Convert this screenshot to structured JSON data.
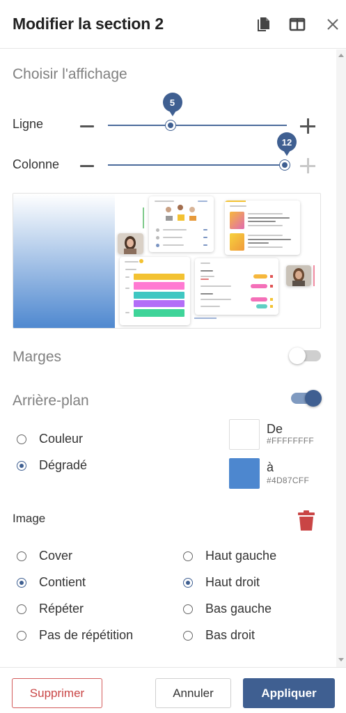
{
  "header": {
    "title": "Modifier la section 2",
    "icons": [
      "copy-icon",
      "columns-layout-icon",
      "close-icon"
    ]
  },
  "layout": {
    "section_title": "Choisir l'affichage",
    "row_label": "Ligne",
    "row_value": "5",
    "row_fraction": 0.36,
    "column_label": "Colonne",
    "column_value": "12",
    "column_fraction": 1.0
  },
  "preview": {
    "icons": [
      "layout-preview-thumbnail"
    ],
    "colors": {
      "gradient_from": "#FFFFFF",
      "gradient_to": "#4D87CF"
    }
  },
  "margins": {
    "label": "Marges",
    "enabled": false
  },
  "background": {
    "label": "Arrière-plan",
    "enabled": true,
    "options": [
      {
        "label": "Couleur",
        "checked": false
      },
      {
        "label": "Dégradé",
        "checked": true
      }
    ],
    "from_label": "De",
    "from_hex": "#FFFFFFFF",
    "from_color": "#FFFFFF",
    "to_label": "à",
    "to_hex": "#4D87CFF",
    "to_color": "#4D87CF"
  },
  "image": {
    "label": "Image",
    "delete_icon": "trash-icon",
    "fit_options": [
      {
        "label": "Cover",
        "checked": false
      },
      {
        "label": "Contient",
        "checked": true
      },
      {
        "label": "Répéter",
        "checked": false
      },
      {
        "label": "Pas de répétition",
        "checked": false
      }
    ],
    "position_options": [
      {
        "label": "Haut gauche",
        "checked": false
      },
      {
        "label": "Haut droit",
        "checked": true
      },
      {
        "label": "Bas gauche",
        "checked": false
      },
      {
        "label": "Bas droit",
        "checked": false
      }
    ]
  },
  "footer": {
    "delete_label": "Supprimer",
    "cancel_label": "Annuler",
    "apply_label": "Appliquer"
  },
  "colors": {
    "primary": "#3F5F91",
    "danger": "#C94545",
    "toggle_off": "#CCCCCC",
    "toggle_on_track": "#7F9AC0"
  }
}
